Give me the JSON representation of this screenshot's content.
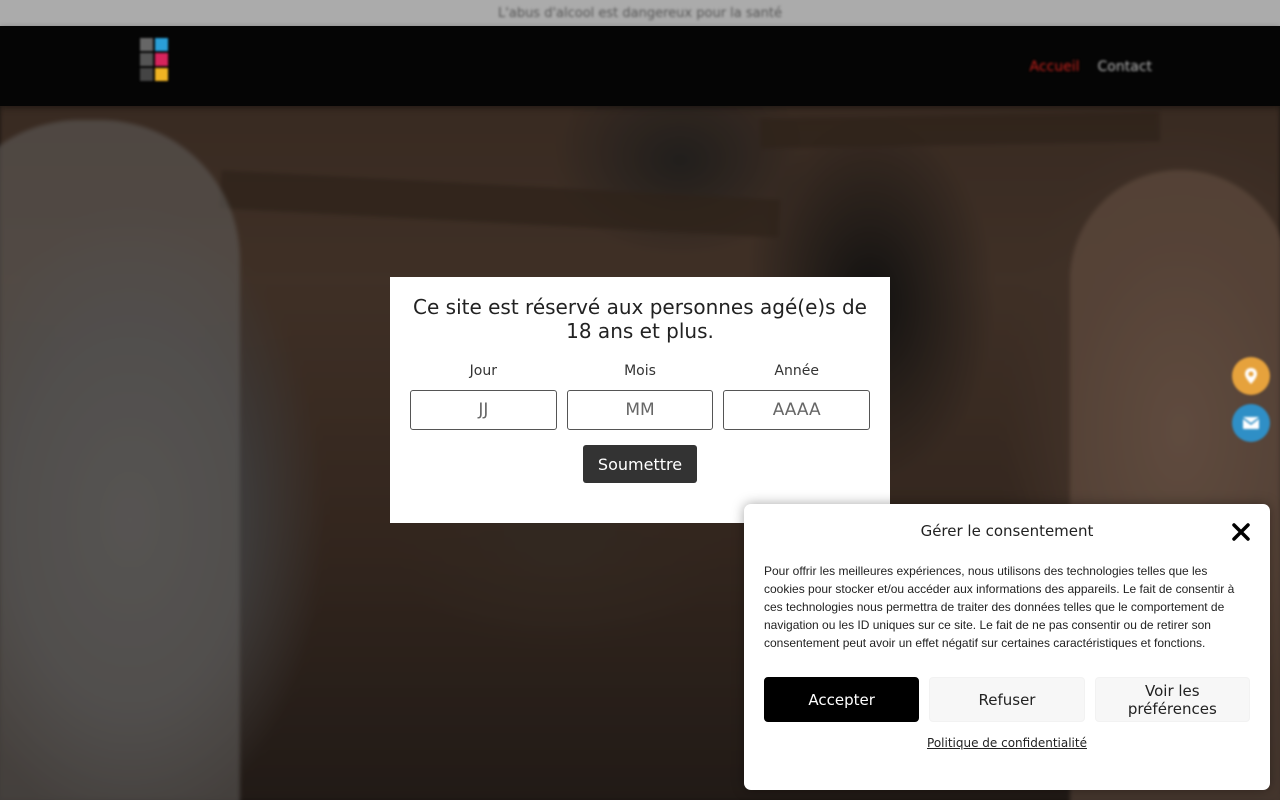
{
  "top_bar": {
    "text": "L'abus d'alcool est dangereux pour la santé"
  },
  "header": {
    "nav": [
      {
        "label": "Accueil",
        "active": true
      },
      {
        "label": "Contact",
        "active": false
      }
    ],
    "logo_colors": [
      "#2a9fd8",
      "#d6245c",
      "#f0b323"
    ]
  },
  "age_gate": {
    "title": "Ce site est réservé aux personnes agé(e)s de 18 ans et plus.",
    "fields": [
      {
        "label": "Jour",
        "placeholder": "JJ"
      },
      {
        "label": "Mois",
        "placeholder": "MM"
      },
      {
        "label": "Année",
        "placeholder": "AAAA"
      }
    ],
    "submit_label": "Soumettre"
  },
  "consent": {
    "title": "Gérer le consentement",
    "body": "Pour offrir les meilleures expériences, nous utilisons des technologies telles que les cookies pour stocker et/ou accéder aux informations des appareils. Le fait de consentir à ces technologies nous permettra de traiter des données telles que le comportement de navigation ou les ID uniques sur ce site. Le fait de ne pas consentir ou de retirer son consentement peut avoir un effet négatif sur certaines caractéristiques et fonctions.",
    "accept_label": "Accepter",
    "refuse_label": "Refuser",
    "preferences_label": "Voir les préférences",
    "policy_link": "Politique de confidentialité"
  },
  "side_buttons": [
    {
      "icon": "map-pin-icon",
      "color": "#e6a23c"
    },
    {
      "icon": "mail-icon",
      "color": "#2f8fc6"
    }
  ]
}
